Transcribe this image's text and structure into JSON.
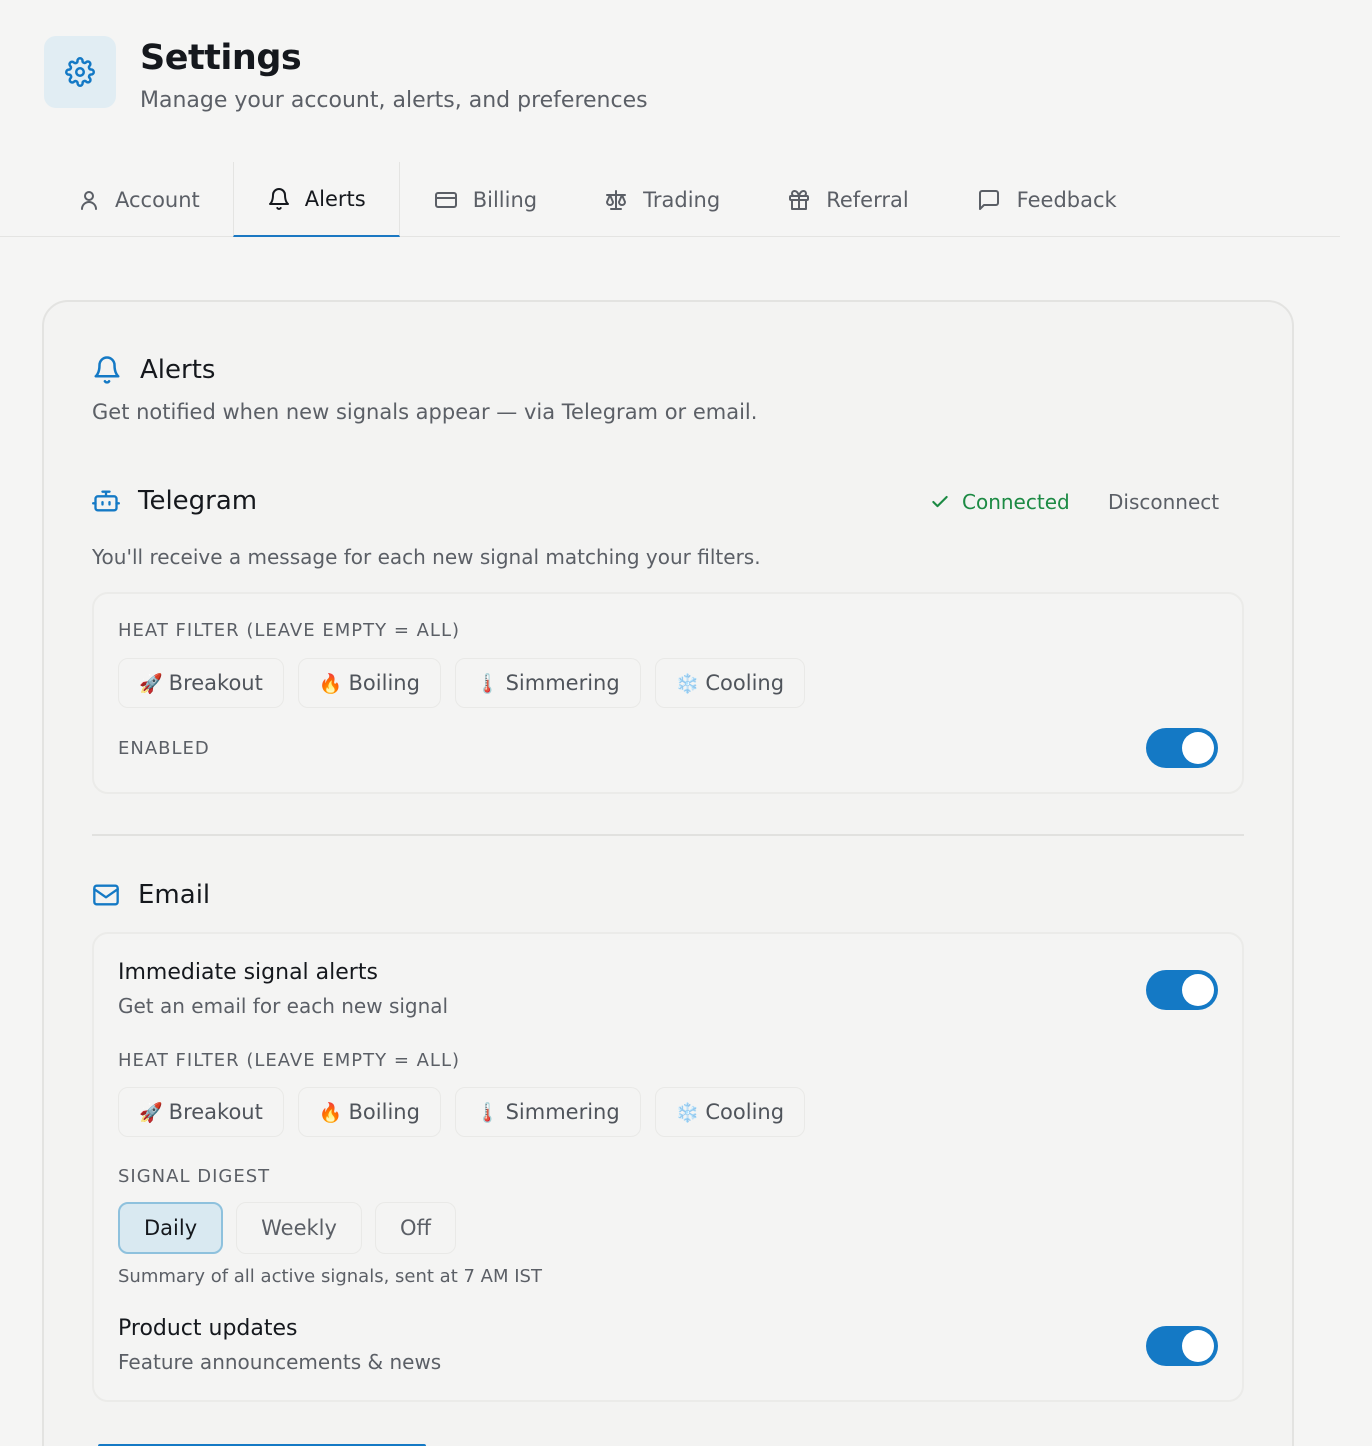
{
  "header": {
    "title": "Settings",
    "subtitle": "Manage your account, alerts, and preferences",
    "icon": "gear-icon"
  },
  "tabs": [
    {
      "label": "Account",
      "icon": "user-icon",
      "active": false
    },
    {
      "label": "Alerts",
      "icon": "bell-icon",
      "active": true
    },
    {
      "label": "Billing",
      "icon": "credit-card-icon",
      "active": false
    },
    {
      "label": "Trading",
      "icon": "scale-icon",
      "active": false
    },
    {
      "label": "Referral",
      "icon": "gift-icon",
      "active": false
    },
    {
      "label": "Feedback",
      "icon": "message-square-icon",
      "active": false
    }
  ],
  "alerts": {
    "title": "Alerts",
    "description": "Get notified when new signals appear — via Telegram or email."
  },
  "telegram": {
    "title": "Telegram",
    "status": "Connected",
    "disconnect_label": "Disconnect",
    "description": "You'll receive a message for each new signal matching your filters.",
    "heat_filter_label": "HEAT FILTER (LEAVE EMPTY = ALL)",
    "chips": [
      {
        "emoji": "🚀",
        "label": "Breakout"
      },
      {
        "emoji": "🔥",
        "label": "Boiling"
      },
      {
        "emoji": "🌡️",
        "label": "Simmering"
      },
      {
        "emoji": "❄️",
        "label": "Cooling"
      }
    ],
    "enabled_label": "ENABLED",
    "enabled": true
  },
  "email": {
    "title": "Email",
    "immediate_title": "Immediate signal alerts",
    "immediate_sub": "Get an email for each new signal",
    "immediate_enabled": true,
    "heat_filter_label": "HEAT FILTER (LEAVE EMPTY = ALL)",
    "chips": [
      {
        "emoji": "🚀",
        "label": "Breakout"
      },
      {
        "emoji": "🔥",
        "label": "Boiling"
      },
      {
        "emoji": "🌡️",
        "label": "Simmering"
      },
      {
        "emoji": "❄️",
        "label": "Cooling"
      }
    ],
    "digest_label": "SIGNAL DIGEST",
    "digest_options": [
      "Daily",
      "Weekly",
      "Off"
    ],
    "digest_selected": "Daily",
    "digest_note": "Summary of all active signals, sent at 7 AM IST",
    "product_title": "Product updates",
    "product_sub": "Feature announcements & news",
    "product_enabled": true
  },
  "colors": {
    "accent": "#1479c5",
    "connected": "#1c8a44"
  }
}
